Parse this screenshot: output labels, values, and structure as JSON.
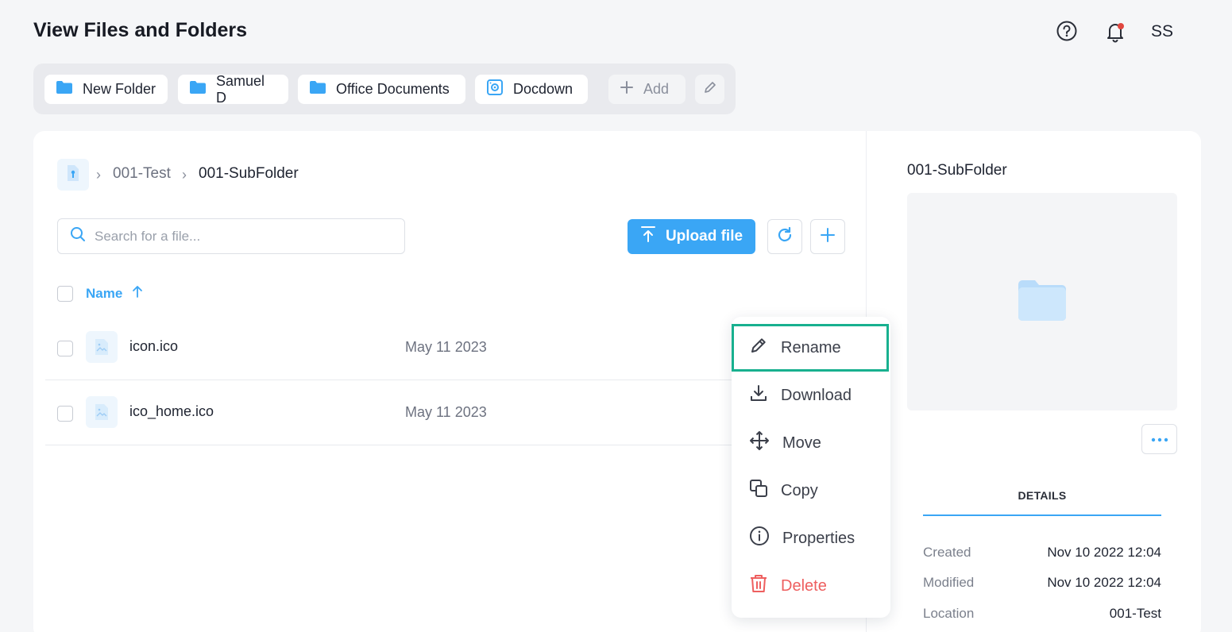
{
  "page": {
    "title": "View Files and Folders"
  },
  "header": {
    "avatar_initials": "SS",
    "help_icon": "help-circle-icon",
    "bell_icon": "bell-icon",
    "notification_color": "#e0463f"
  },
  "quick_access": [
    {
      "label": "New Folder",
      "icon": "folder-icon"
    },
    {
      "label": "Samuel D",
      "icon": "folder-icon"
    },
    {
      "label": "Office Documents",
      "icon": "folder-icon"
    },
    {
      "label": "Docdown",
      "icon": "drive-icon"
    }
  ],
  "quick_add_label": "Add",
  "breadcrumb": {
    "items": [
      "001-Test",
      "001-SubFolder"
    ]
  },
  "search": {
    "placeholder": "Search for a file..."
  },
  "toolbar": {
    "upload_label": "Upload file"
  },
  "table": {
    "name_header": "Name",
    "rows": [
      {
        "name": "icon.ico",
        "date": "May 11 2023"
      },
      {
        "name": "ico_home.ico",
        "date": "May 11 2023"
      }
    ]
  },
  "context_menu": {
    "items": [
      {
        "label": "Rename",
        "icon": "pencil-icon"
      },
      {
        "label": "Download",
        "icon": "download-icon"
      },
      {
        "label": "Move",
        "icon": "move-icon"
      },
      {
        "label": "Copy",
        "icon": "copy-icon"
      },
      {
        "label": "Properties",
        "icon": "info-icon"
      },
      {
        "label": "Delete",
        "icon": "trash-icon"
      }
    ]
  },
  "details_panel": {
    "title": "001-SubFolder",
    "tab": "DETAILS",
    "fields": [
      {
        "label": "Created",
        "value": "Nov 10 2022 12:04"
      },
      {
        "label": "Modified",
        "value": "Nov 10 2022 12:04"
      },
      {
        "label": "Location",
        "value": "001-Test"
      }
    ]
  },
  "colors": {
    "accent": "#3aa6f5",
    "highlight": "#18b08f",
    "danger": "#ee5f5f"
  }
}
